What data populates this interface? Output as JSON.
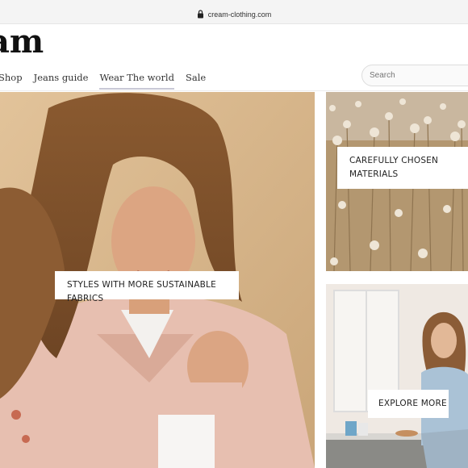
{
  "browser": {
    "url": "cream-clothing.com"
  },
  "header": {
    "logo_text": "am",
    "nav": [
      {
        "label": "Shop"
      },
      {
        "label": "Jeans guide"
      },
      {
        "label": "Wear The world",
        "active": true
      },
      {
        "label": "Sale"
      }
    ],
    "search_placeholder": "Search"
  },
  "tiles": {
    "hero": {
      "label": "STYLES WITH MORE SUSTAINABLE FABRICS"
    },
    "materials": {
      "label_line1": "CAREFULLY CHOSEN",
      "label_line2": "MATERIALS"
    },
    "explore": {
      "label": "EXPLORE MORE"
    }
  },
  "colors": {
    "hero_background": "#d9b98f",
    "cotton_field": "#b39770",
    "nav_active_underline": "#c9c9d6"
  }
}
